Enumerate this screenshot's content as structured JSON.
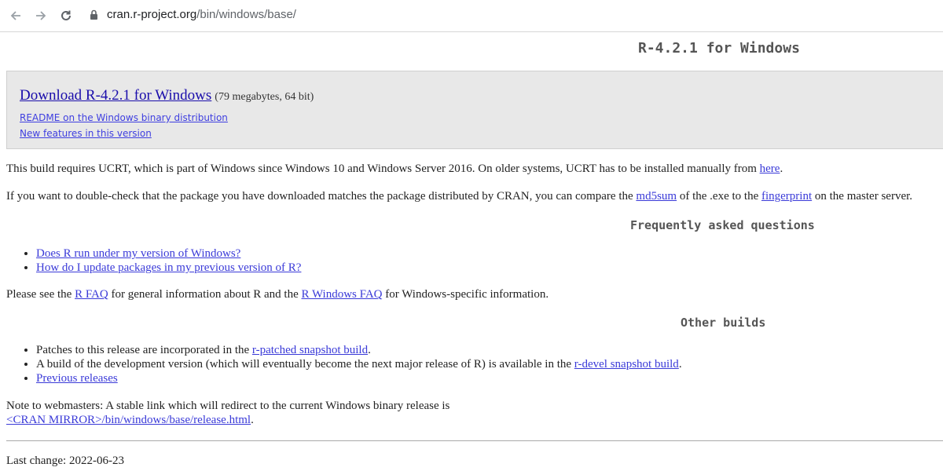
{
  "browser": {
    "url_host": "cran.r-project.org",
    "url_path": "/bin/windows/base/"
  },
  "page_title": "R-4.2.1 for Windows",
  "download": {
    "link_label": "Download R-4.2.1 for Windows",
    "size_note": "(79 megabytes, 64 bit)",
    "readme_link": "README on the Windows binary distribution",
    "features_link": "New features in this version"
  },
  "ucrt": {
    "text": "This build requires UCRT, which is part of Windows since Windows 10 and Windows Server 2016. On older systems, UCRT has to be installed manually from ",
    "link": "here",
    "after": "."
  },
  "checksum": {
    "text1": "If you want to double-check that the package you have downloaded matches the package distributed by CRAN, you can compare the ",
    "link1": "md5sum",
    "text2": " of the .exe to the ",
    "link2": "fingerprint",
    "text3": " on the master server."
  },
  "faq": {
    "heading": "Frequently asked questions",
    "items": [
      "Does R run under my version of Windows?",
      "How do I update packages in my previous version of R?"
    ]
  },
  "faq_note": {
    "text1": "Please see the ",
    "link1": "R FAQ",
    "text2": " for general information about R and the ",
    "link2": "R Windows FAQ",
    "text3": " for Windows-specific information."
  },
  "other_builds": {
    "heading": "Other builds",
    "item1_text": "Patches to this release are incorporated in the ",
    "item1_link": "r-patched snapshot build",
    "item1_after": ".",
    "item2_text": "A build of the development version (which will eventually become the next major release of R) is available in the ",
    "item2_link": "r-devel snapshot build",
    "item2_after": ".",
    "item3_link": "Previous releases"
  },
  "webmasters": {
    "text": "Note to webmasters: A stable link which will redirect to the current Windows binary release is",
    "link": "<CRAN MIRROR>/bin/windows/base/release.html",
    "after": "."
  },
  "last_change": "Last change: 2022-06-23"
}
